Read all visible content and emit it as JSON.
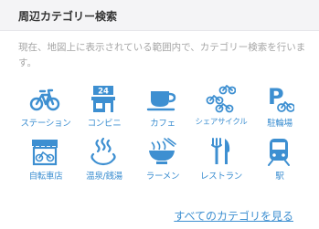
{
  "header": {
    "title": "周辺カテゴリー検索"
  },
  "description": "現在、地図上に表示されている範囲内で、カテゴリー検索を行います。",
  "accent_color": "#3d8fd1",
  "categories": [
    {
      "label": "ステーション",
      "icon": "bicycle-station-icon"
    },
    {
      "label": "コンビニ",
      "icon": "convenience-store-icon",
      "badge": "24"
    },
    {
      "label": "カフェ",
      "icon": "coffee-cup-icon"
    },
    {
      "label": "シェアサイクル",
      "icon": "share-cycle-icon"
    },
    {
      "label": "駐輪場",
      "icon": "bicycle-parking-icon",
      "badge": "P"
    },
    {
      "label": "自転車店",
      "icon": "bicycle-shop-icon"
    },
    {
      "label": "温泉/銭湯",
      "icon": "hot-spring-icon"
    },
    {
      "label": "ラーメン",
      "icon": "ramen-bowl-icon"
    },
    {
      "label": "レストラン",
      "icon": "fork-knife-icon"
    },
    {
      "label": "駅",
      "icon": "train-icon"
    }
  ],
  "see_all_link": "すべてのカテゴリを見る"
}
